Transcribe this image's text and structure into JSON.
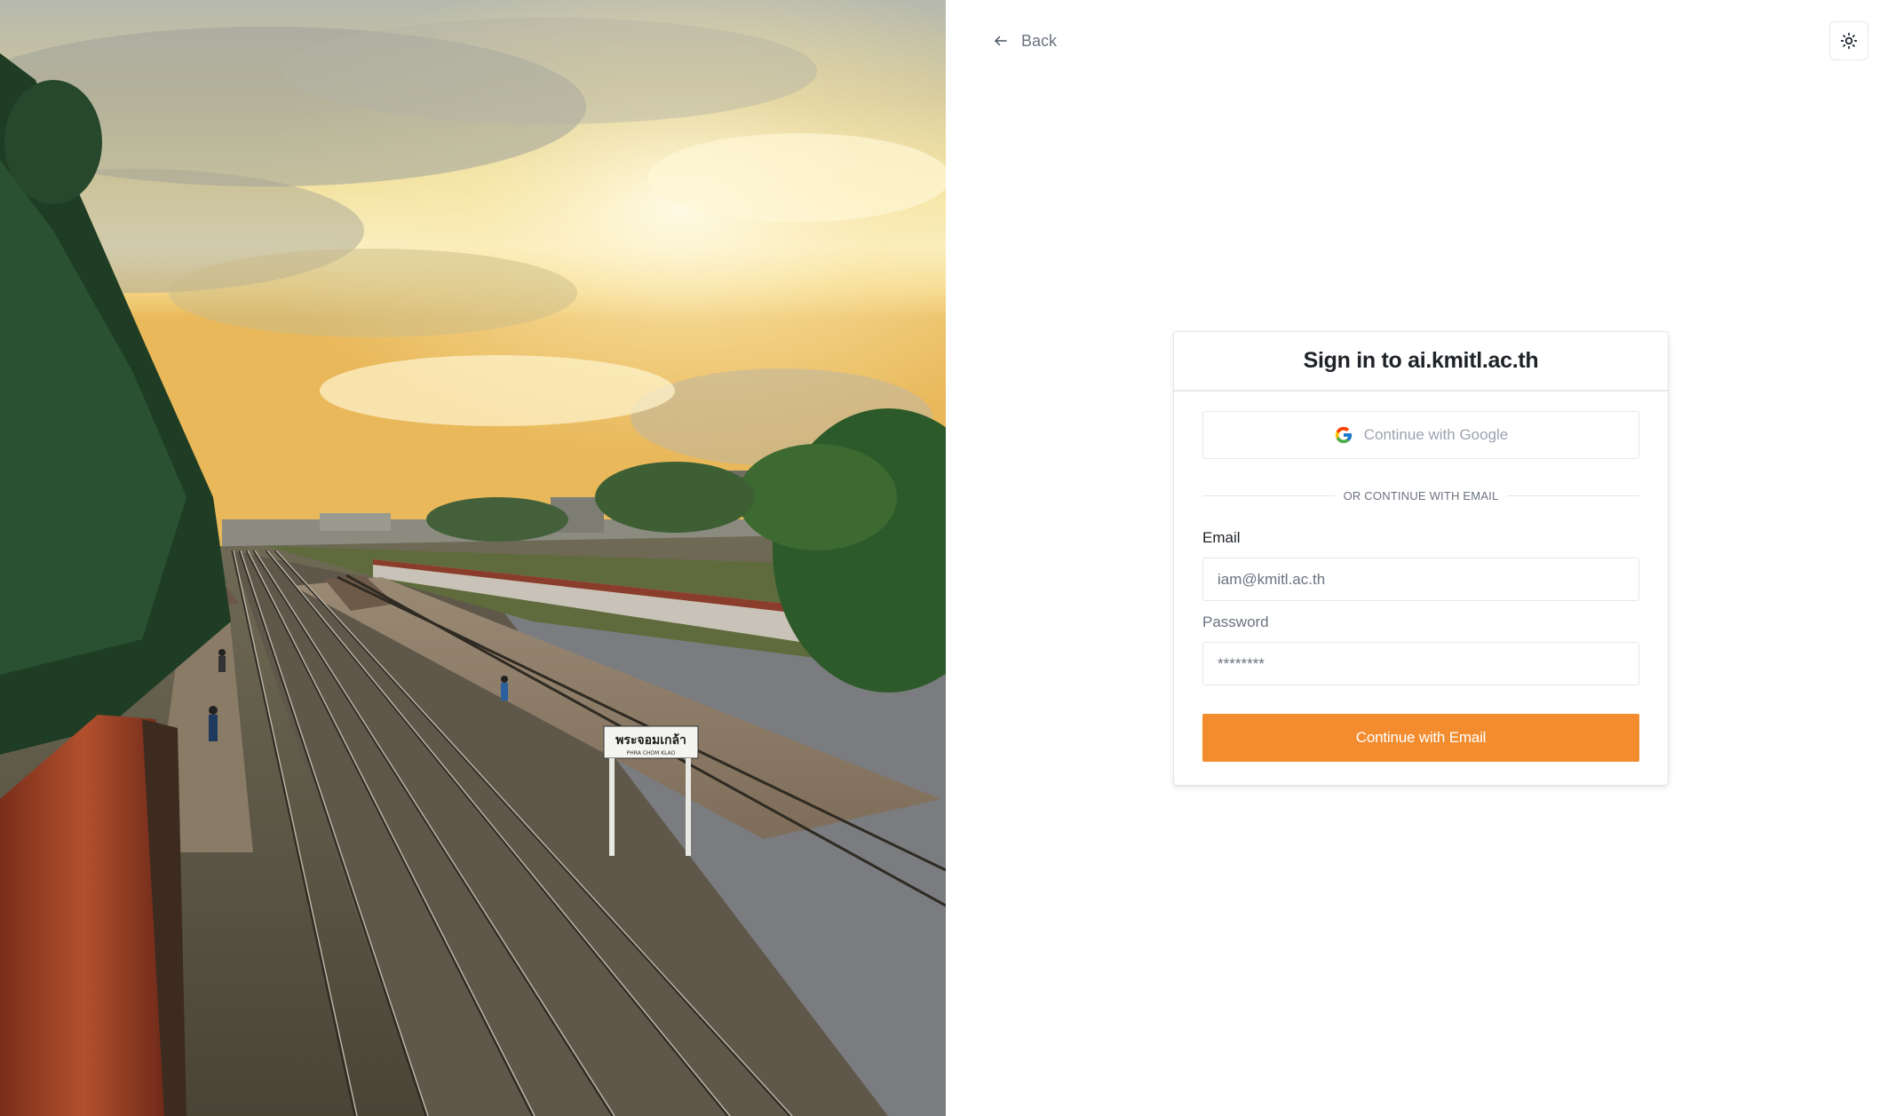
{
  "hero": {
    "station_sign_text": "พระจอมเกล้า",
    "station_sign_subtext": "PHRA CHOM KLAO"
  },
  "nav": {
    "back_label": "Back",
    "back_icon": "arrow-left-icon",
    "theme_icon": "sun-icon"
  },
  "signin": {
    "title": "Sign in to ai.kmitl.ac.th",
    "google_label": "Continue with Google",
    "google_icon": "google-icon",
    "divider_text": "OR CONTINUE WITH EMAIL",
    "email_label": "Email",
    "email_placeholder": "iam@kmitl.ac.th",
    "password_label": "Password",
    "password_placeholder": "********",
    "submit_label": "Continue with Email"
  },
  "colors": {
    "accent": "#f28c2e",
    "border": "#e5e7eb",
    "muted_text": "#6b7280"
  }
}
